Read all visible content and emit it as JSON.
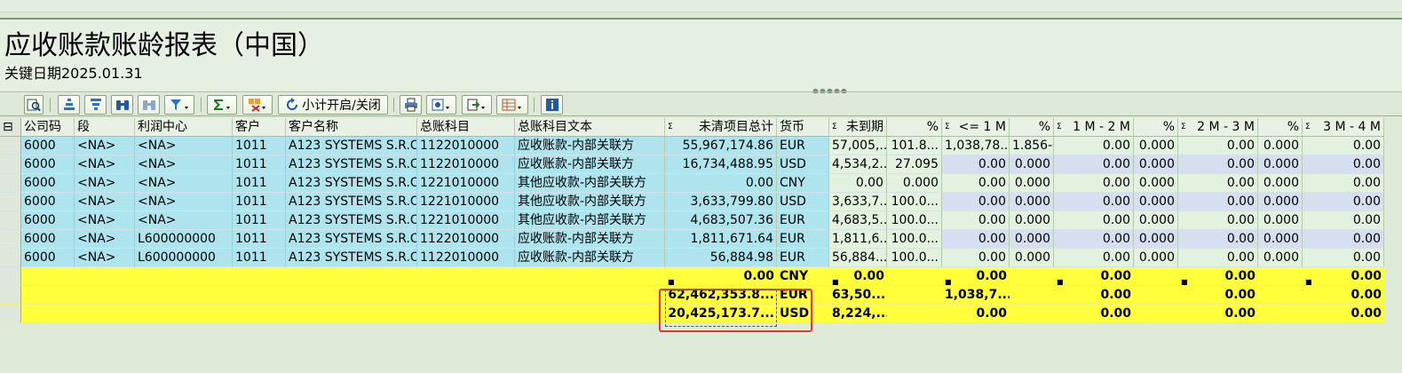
{
  "report": {
    "title": "应收账款账龄报表（中国）",
    "subtitle": "关键日期2025.01.31"
  },
  "toolbar": {
    "subtotal_label": "小计开启/关闭"
  },
  "columns": [
    {
      "label": "公司码"
    },
    {
      "label": "段"
    },
    {
      "label": "利润中心"
    },
    {
      "label": "客户"
    },
    {
      "label": "客户名称"
    },
    {
      "label": "总账科目"
    },
    {
      "label": "总账科目文本"
    },
    {
      "label": "未清项目总计"
    },
    {
      "label": "货币"
    },
    {
      "label": "未到期"
    },
    {
      "label": "%"
    },
    {
      "label": "<=   1 M"
    },
    {
      "label": "%"
    },
    {
      "label": "1 M -   2 M"
    },
    {
      "label": "%"
    },
    {
      "label": "2 M -   3 M"
    },
    {
      "label": "%"
    },
    {
      "label": "3 M -   4 M"
    }
  ],
  "rows": [
    [
      "6000",
      "<NA>",
      "<NA>",
      "1011",
      "A123 SYSTEMS S.R.O",
      "1122010000",
      "应收账款-内部关联方",
      "55,967,174.86",
      "EUR",
      "57,005,...",
      "101.8...",
      "1,038,78...",
      "1.856-",
      "0.00",
      "0.000",
      "0.00",
      "0.000",
      "0.00"
    ],
    [
      "6000",
      "<NA>",
      "<NA>",
      "1011",
      "A123 SYSTEMS S.R.O",
      "1122010000",
      "应收账款-内部关联方",
      "16,734,488.95",
      "USD",
      "4,534,2...",
      "27.095",
      "0.00",
      "0.000",
      "0.00",
      "0.000",
      "0.00",
      "0.000",
      "0.00"
    ],
    [
      "6000",
      "<NA>",
      "<NA>",
      "1011",
      "A123 SYSTEMS S.R.O",
      "1221010000",
      "其他应收款-内部关联方",
      "0.00",
      "CNY",
      "0.00",
      "0.000",
      "0.00",
      "0.000",
      "0.00",
      "0.000",
      "0.00",
      "0.000",
      "0.00"
    ],
    [
      "6000",
      "<NA>",
      "<NA>",
      "1011",
      "A123 SYSTEMS S.R.O",
      "1221010000",
      "其他应收款-内部关联方",
      "3,633,799.80",
      "USD",
      "3,633,7...",
      "100.0...",
      "0.00",
      "0.000",
      "0.00",
      "0.000",
      "0.00",
      "0.000",
      "0.00"
    ],
    [
      "6000",
      "<NA>",
      "<NA>",
      "1011",
      "A123 SYSTEMS S.R.O",
      "1221010000",
      "其他应收款-内部关联方",
      "4,683,507.36",
      "EUR",
      "4,683,5...",
      "100.0...",
      "0.00",
      "0.000",
      "0.00",
      "0.000",
      "0.00",
      "0.000",
      "0.00"
    ],
    [
      "6000",
      "<NA>",
      "L600000000",
      "1011",
      "A123 SYSTEMS S.R.O",
      "1122010000",
      "应收账款-内部关联方",
      "1,811,671.64",
      "EUR",
      "1,811,6...",
      "100.0...",
      "0.00",
      "0.000",
      "0.00",
      "0.000",
      "0.00",
      "0.000",
      "0.00"
    ],
    [
      "6000",
      "<NA>",
      "L600000000",
      "1011",
      "A123 SYSTEMS S.R.O",
      "1122010000",
      "应收账款-内部关联方",
      "56,884.98",
      "EUR",
      "56,884....",
      "100.0...",
      "0.00",
      "0.000",
      "0.00",
      "0.000",
      "0.00",
      "0.000",
      "0.00"
    ]
  ],
  "totals": [
    {
      "total": "0.00",
      "currency": "CNY",
      "not_due": "0.00",
      "m1": "0.00",
      "m1_2": "0.00",
      "m2_3": "0.00",
      "m3_4": "0.00"
    },
    {
      "total": "62,462,353.8...",
      "currency": "EUR",
      "not_due": "63,50...",
      "m1": "1,038,7...",
      "m1_2": "0.00",
      "m2_3": "0.00",
      "m3_4": "0.00"
    },
    {
      "total": "20,425,173.7...",
      "currency": "USD",
      "not_due": "8,224,...",
      "m1": "0.00",
      "m1_2": "0.00",
      "m2_3": "0.00",
      "m3_4": "0.00"
    }
  ]
}
